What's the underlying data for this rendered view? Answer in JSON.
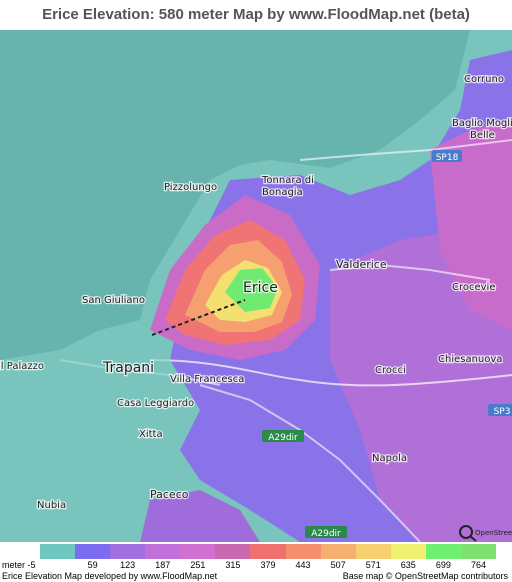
{
  "title": "Erice Elevation: 580 meter Map by www.FloodMap.net (beta)",
  "map": {
    "places": [
      {
        "name": "Erice"
      },
      {
        "name": "Valderice"
      },
      {
        "name": "Trapani"
      },
      {
        "name": "Paceco"
      },
      {
        "name": "San Giuliano"
      },
      {
        "name": "Pizzolungo"
      },
      {
        "name": "Tonnara di"
      },
      {
        "name": "Bonagia"
      },
      {
        "name": "Villa Francesca"
      },
      {
        "name": "Casa Leggiardo"
      },
      {
        "name": "Xitta"
      },
      {
        "name": "Nubia"
      },
      {
        "name": "Crocci"
      },
      {
        "name": "Chiesanuova"
      },
      {
        "name": "Crocevie"
      },
      {
        "name": "Napola"
      },
      {
        "name": "Corruno"
      },
      {
        "name": "Baglio Moglie"
      },
      {
        "name": "Belle"
      },
      {
        "name": "il Palazzo"
      }
    ],
    "roads": [
      {
        "name": "SP18"
      },
      {
        "name": "A29dir"
      },
      {
        "name": "A29dir"
      },
      {
        "name": "SP3"
      }
    ],
    "logo": "OpenStreetMap"
  },
  "legend": {
    "unit": "meter",
    "ticks": [
      "-5",
      "59",
      "123",
      "187",
      "251",
      "315",
      "379",
      "443",
      "507",
      "571",
      "635",
      "699",
      "764"
    ],
    "colors": [
      "#6fc8c0",
      "#7b6cf0",
      "#a070e0",
      "#c070d8",
      "#d070d0",
      "#c868b0",
      "#f07070",
      "#f49070",
      "#f5b070",
      "#f6d070",
      "#f0f070",
      "#70f070",
      "#80e070"
    ]
  },
  "footer": {
    "left": "Erice Elevation Map developed by www.FloodMap.net",
    "right": "Base map © OpenStreetMap contributors"
  }
}
